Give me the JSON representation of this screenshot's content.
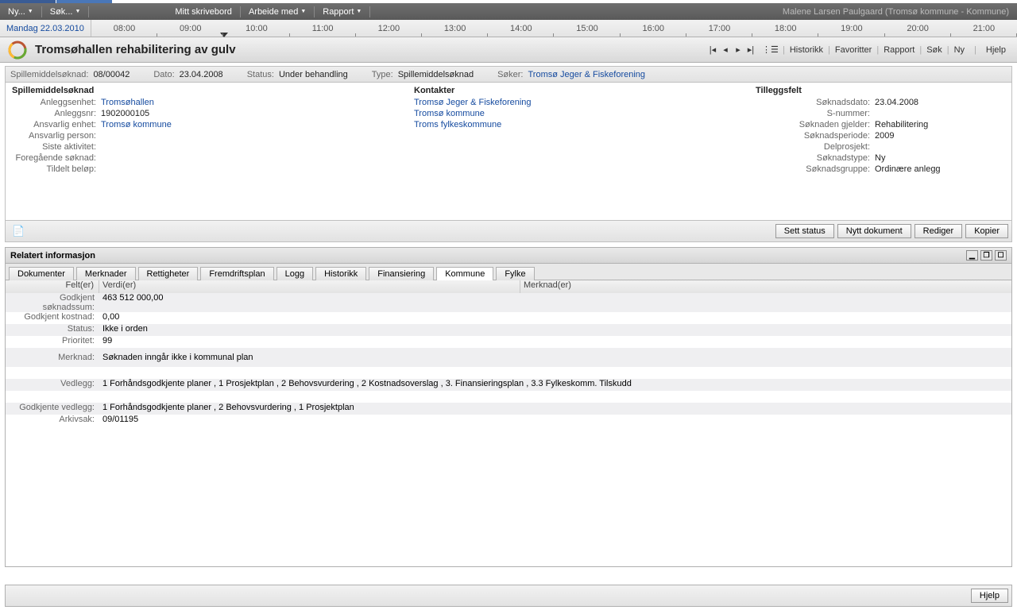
{
  "topbar": {
    "ny": "Ny...",
    "sok": "Søk...",
    "menu1": "Mitt skrivebord",
    "menu2": "Arbeide med",
    "menu3": "Rapport",
    "user": "Malene Larsen Paulgaard (Tromsø kommune - Kommune)"
  },
  "timeline": {
    "date": "Mandag 22.03.2010",
    "hours": [
      "08:00",
      "09:00",
      "10:00",
      "11:00",
      "12:00",
      "13:00",
      "14:00",
      "15:00",
      "16:00",
      "17:00",
      "18:00",
      "19:00",
      "20:00",
      "21:00"
    ]
  },
  "header": {
    "title": "Tromsøhallen rehabilitering av gulv",
    "links": {
      "historikk": "Historikk",
      "favoritter": "Favoritter",
      "rapport": "Rapport",
      "sok": "Søk",
      "ny": "Ny",
      "hjelp": "Hjelp"
    }
  },
  "info": {
    "l1": "Spillemiddelsøknad:",
    "v1": "08/00042",
    "l2": "Dato:",
    "v2": "23.04.2008",
    "l3": "Status:",
    "v3": "Under behandling",
    "l4": "Type:",
    "v4": "Spillemiddelsøknad",
    "l5": "Søker:",
    "v5": "Tromsø Jeger & Fiskeforening"
  },
  "left": {
    "head": "Spillemiddelsøknad",
    "f1l": "Anleggsenhet:",
    "f1v": "Tromsøhallen",
    "f2l": "Anleggsnr:",
    "f2v": "1902000105",
    "f3l": "Ansvarlig enhet:",
    "f3v": "Tromsø kommune",
    "f4l": "Ansvarlig person:",
    "f5l": "Siste aktivitet:",
    "f6l": "Foregående søknad:",
    "f7l": "Tildelt beløp:"
  },
  "mid": {
    "head": "Kontakter",
    "c1": "Tromsø Jeger & Fiskeforening",
    "c2": "Tromsø kommune",
    "c3": "Troms fylkeskommune"
  },
  "right": {
    "head": "Tilleggsfelt",
    "f1l": "Søknadsdato:",
    "f1v": "23.04.2008",
    "f2l": "S-nummer:",
    "f3l": "Søknaden gjelder:",
    "f3v": "Rehabilitering",
    "f4l": "Søknadsperiode:",
    "f4v": "2009",
    "f5l": "Delprosjekt:",
    "f6l": "Søknadstype:",
    "f6v": "Ny",
    "f7l": "Søknadsgruppe:",
    "f7v": "Ordinære anlegg"
  },
  "actions": {
    "sett": "Sett status",
    "nytt": "Nytt dokument",
    "rediger": "Rediger",
    "kopier": "Kopier"
  },
  "rel": {
    "title": "Relatert informasjon"
  },
  "tabs": [
    "Dokumenter",
    "Merknader",
    "Rettigheter",
    "Fremdriftsplan",
    "Logg",
    "Historikk",
    "Finansiering",
    "Kommune",
    "Fylke"
  ],
  "gridhead": {
    "c1": "Felt(er)",
    "c2": "Verdi(er)",
    "c3": "Merknad(er)"
  },
  "rows": {
    "r1l": "Godkjent søknadssum:",
    "r1v": "463 512 000,00",
    "r2l": "Godkjent kostnad:",
    "r2v": "0,00",
    "r3l": "Status:",
    "r3v": "Ikke i orden",
    "r4l": "Prioritet:",
    "r4v": "99",
    "r5l": "Merknad:",
    "r5v": "Søknaden inngår ikke i kommunal plan",
    "r6l": "Vedlegg:",
    "r6v": "1 Forhåndsgodkjente planer , 1 Prosjektplan , 2 Behovsvurdering , 2 Kostnadsoverslag , 3. Finansieringsplan , 3.3 Fylkeskomm. Tilskudd",
    "r7l": "Godkjente vedlegg:",
    "r7v": "1 Forhåndsgodkjente planer , 2 Behovsvurdering , 1 Prosjektplan",
    "r8l": "Arkivsak:",
    "r8v": "09/01195"
  },
  "footer": {
    "hjelp": "Hjelp"
  }
}
